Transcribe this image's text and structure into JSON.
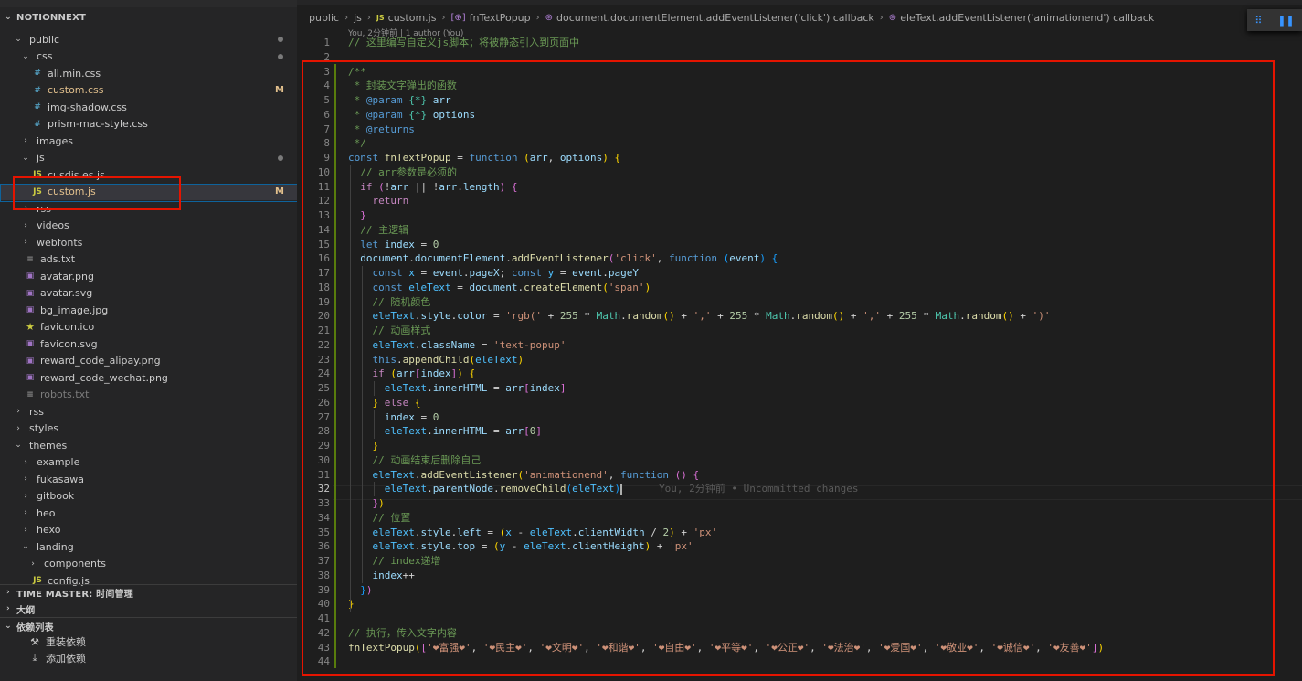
{
  "sidebar": {
    "root_title": "NOTIONNEXT",
    "items": [
      {
        "label": "public",
        "kind": "folder-open",
        "depth": 0,
        "status": "dot"
      },
      {
        "label": "css",
        "kind": "folder-open",
        "depth": 1,
        "status": "dot"
      },
      {
        "label": "all.min.css",
        "kind": "css",
        "depth": 2,
        "status": ""
      },
      {
        "label": "custom.css",
        "kind": "css",
        "depth": 2,
        "status": "M",
        "modified": true
      },
      {
        "label": "img-shadow.css",
        "kind": "css",
        "depth": 2,
        "status": ""
      },
      {
        "label": "prism-mac-style.css",
        "kind": "css",
        "depth": 2,
        "status": ""
      },
      {
        "label": "images",
        "kind": "folder",
        "depth": 1,
        "status": ""
      },
      {
        "label": "js",
        "kind": "folder-open",
        "depth": 1,
        "status": "dot"
      },
      {
        "label": "cusdis.es.js",
        "kind": "js",
        "depth": 2,
        "status": ""
      },
      {
        "label": "custom.js",
        "kind": "js",
        "depth": 2,
        "status": "M",
        "modified": true,
        "selected": true
      },
      {
        "label": "rss",
        "kind": "folder",
        "depth": 1,
        "status": ""
      },
      {
        "label": "videos",
        "kind": "folder",
        "depth": 1,
        "status": ""
      },
      {
        "label": "webfonts",
        "kind": "folder",
        "depth": 1,
        "status": ""
      },
      {
        "label": "ads.txt",
        "kind": "txt",
        "depth": 1,
        "status": ""
      },
      {
        "label": "avatar.png",
        "kind": "img",
        "depth": 1,
        "status": ""
      },
      {
        "label": "avatar.svg",
        "kind": "img",
        "depth": 1,
        "status": ""
      },
      {
        "label": "bg_image.jpg",
        "kind": "img",
        "depth": 1,
        "status": ""
      },
      {
        "label": "favicon.ico",
        "kind": "star",
        "depth": 1,
        "status": ""
      },
      {
        "label": "favicon.svg",
        "kind": "img",
        "depth": 1,
        "status": ""
      },
      {
        "label": "reward_code_alipay.png",
        "kind": "img",
        "depth": 1,
        "status": ""
      },
      {
        "label": "reward_code_wechat.png",
        "kind": "img",
        "depth": 1,
        "status": ""
      },
      {
        "label": "robots.txt",
        "kind": "txt",
        "depth": 1,
        "status": "",
        "ignored": true
      },
      {
        "label": "rss",
        "kind": "folder",
        "depth": 0,
        "status": ""
      },
      {
        "label": "styles",
        "kind": "folder",
        "depth": 0,
        "status": ""
      },
      {
        "label": "themes",
        "kind": "folder-open",
        "depth": 0,
        "status": ""
      },
      {
        "label": "example",
        "kind": "folder",
        "depth": 1,
        "status": ""
      },
      {
        "label": "fukasawa",
        "kind": "folder",
        "depth": 1,
        "status": ""
      },
      {
        "label": "gitbook",
        "kind": "folder",
        "depth": 1,
        "status": ""
      },
      {
        "label": "heo",
        "kind": "folder",
        "depth": 1,
        "status": ""
      },
      {
        "label": "hexo",
        "kind": "folder",
        "depth": 1,
        "status": ""
      },
      {
        "label": "landing",
        "kind": "folder-open",
        "depth": 1,
        "status": ""
      },
      {
        "label": "components",
        "kind": "folder",
        "depth": 2,
        "status": ""
      },
      {
        "label": "config.js",
        "kind": "js",
        "depth": 2,
        "status": ""
      }
    ],
    "timeline_title": "TIME MASTER: 时间管理",
    "outline_title": "大纲",
    "deps_title": "依赖列表",
    "deps": [
      {
        "label": "重装依赖",
        "icon": "wrench-icon"
      },
      {
        "label": "添加依赖",
        "icon": "download-icon"
      }
    ]
  },
  "breadcrumb": [
    "public",
    "js",
    "custom.js",
    "fnTextPopup",
    "document.documentElement.addEventListener('click') callback",
    "eleText.addEventListener('animationend') callback"
  ],
  "blame_header": "You, 2分钟前 | 1 author (You)",
  "inline_blame": "You, 2分钟前 • Uncommitted changes",
  "active_line": 32,
  "colors": {
    "accent": "#0e639c",
    "highlight_box": "#e51400",
    "git_added": "#587c0c"
  },
  "code": [
    [
      [
        "t-cm",
        "// 这里编写自定义js脚本；将被静态引入到页面中"
      ]
    ],
    [],
    [
      [
        "t-cm",
        "/**"
      ]
    ],
    [
      [
        "t-cm",
        " * 封装文字弹出的函数"
      ]
    ],
    [
      [
        "t-cm",
        " * "
      ],
      [
        "t-doc",
        "@param"
      ],
      [
        "t-cm",
        " "
      ],
      [
        "t-ty",
        "{*}"
      ],
      [
        "t-cm",
        " "
      ],
      [
        "t-var",
        "arr"
      ]
    ],
    [
      [
        "t-cm",
        " * "
      ],
      [
        "t-doc",
        "@param"
      ],
      [
        "t-cm",
        " "
      ],
      [
        "t-ty",
        "{*}"
      ],
      [
        "t-cm",
        " "
      ],
      [
        "t-var",
        "options"
      ]
    ],
    [
      [
        "t-cm",
        " * "
      ],
      [
        "t-doc",
        "@returns"
      ]
    ],
    [
      [
        "t-cm",
        " */"
      ]
    ],
    [
      [
        "t-kw",
        "const"
      ],
      [
        "t-pu",
        " "
      ],
      [
        "t-fn",
        "fnTextPopup"
      ],
      [
        "t-pu",
        " = "
      ],
      [
        "t-kw",
        "function"
      ],
      [
        "t-pu",
        " "
      ],
      [
        "t-br1",
        "("
      ],
      [
        "t-var",
        "arr"
      ],
      [
        "t-pu",
        ", "
      ],
      [
        "t-var",
        "options"
      ],
      [
        "t-br1",
        ")"
      ],
      [
        "t-pu",
        " "
      ],
      [
        "t-br1",
        "{"
      ]
    ],
    [
      [
        "t-pu",
        "  "
      ],
      [
        "t-cm",
        "// arr参数是必须的"
      ]
    ],
    [
      [
        "t-pu",
        "  "
      ],
      [
        "t-kw2",
        "if"
      ],
      [
        "t-pu",
        " "
      ],
      [
        "t-br2",
        "("
      ],
      [
        "t-pu",
        "!"
      ],
      [
        "t-var",
        "arr"
      ],
      [
        "t-pu",
        " || !"
      ],
      [
        "t-var",
        "arr"
      ],
      [
        "t-pu",
        "."
      ],
      [
        "t-var",
        "length"
      ],
      [
        "t-br2",
        ")"
      ],
      [
        "t-pu",
        " "
      ],
      [
        "t-br2",
        "{"
      ]
    ],
    [
      [
        "t-pu",
        "    "
      ],
      [
        "t-kw2",
        "return"
      ]
    ],
    [
      [
        "t-pu",
        "  "
      ],
      [
        "t-br2",
        "}"
      ]
    ],
    [
      [
        "t-pu",
        "  "
      ],
      [
        "t-cm",
        "// 主逻辑"
      ]
    ],
    [
      [
        "t-pu",
        "  "
      ],
      [
        "t-kw",
        "let"
      ],
      [
        "t-pu",
        " "
      ],
      [
        "t-var",
        "index"
      ],
      [
        "t-pu",
        " = "
      ],
      [
        "t-num",
        "0"
      ]
    ],
    [
      [
        "t-pu",
        "  "
      ],
      [
        "t-var",
        "document"
      ],
      [
        "t-pu",
        "."
      ],
      [
        "t-var",
        "documentElement"
      ],
      [
        "t-pu",
        "."
      ],
      [
        "t-fn",
        "addEventListener"
      ],
      [
        "t-br2",
        "("
      ],
      [
        "t-str",
        "'click'"
      ],
      [
        "t-pu",
        ", "
      ],
      [
        "t-kw",
        "function"
      ],
      [
        "t-pu",
        " "
      ],
      [
        "t-br3",
        "("
      ],
      [
        "t-var",
        "event"
      ],
      [
        "t-br3",
        ")"
      ],
      [
        "t-pu",
        " "
      ],
      [
        "t-br3",
        "{"
      ]
    ],
    [
      [
        "t-pu",
        "    "
      ],
      [
        "t-kw",
        "const"
      ],
      [
        "t-pu",
        " "
      ],
      [
        "t-const",
        "x"
      ],
      [
        "t-pu",
        " = "
      ],
      [
        "t-var",
        "event"
      ],
      [
        "t-pu",
        "."
      ],
      [
        "t-var",
        "pageX"
      ],
      [
        "t-pu",
        "; "
      ],
      [
        "t-kw",
        "const"
      ],
      [
        "t-pu",
        " "
      ],
      [
        "t-const",
        "y"
      ],
      [
        "t-pu",
        " = "
      ],
      [
        "t-var",
        "event"
      ],
      [
        "t-pu",
        "."
      ],
      [
        "t-var",
        "pageY"
      ]
    ],
    [
      [
        "t-pu",
        "    "
      ],
      [
        "t-kw",
        "const"
      ],
      [
        "t-pu",
        " "
      ],
      [
        "t-const",
        "eleText"
      ],
      [
        "t-pu",
        " = "
      ],
      [
        "t-var",
        "document"
      ],
      [
        "t-pu",
        "."
      ],
      [
        "t-fn",
        "createElement"
      ],
      [
        "t-br1",
        "("
      ],
      [
        "t-str",
        "'span'"
      ],
      [
        "t-br1",
        ")"
      ]
    ],
    [
      [
        "t-pu",
        "    "
      ],
      [
        "t-cm",
        "// 随机颜色"
      ]
    ],
    [
      [
        "t-pu",
        "    "
      ],
      [
        "t-const",
        "eleText"
      ],
      [
        "t-pu",
        "."
      ],
      [
        "t-var",
        "style"
      ],
      [
        "t-pu",
        "."
      ],
      [
        "t-var",
        "color"
      ],
      [
        "t-pu",
        " = "
      ],
      [
        "t-str",
        "'rgb('"
      ],
      [
        "t-pu",
        " + "
      ],
      [
        "t-num",
        "255"
      ],
      [
        "t-pu",
        " * "
      ],
      [
        "t-ty",
        "Math"
      ],
      [
        "t-pu",
        "."
      ],
      [
        "t-fn",
        "random"
      ],
      [
        "t-br1",
        "()"
      ],
      [
        "t-pu",
        " + "
      ],
      [
        "t-str",
        "','"
      ],
      [
        "t-pu",
        " + "
      ],
      [
        "t-num",
        "255"
      ],
      [
        "t-pu",
        " * "
      ],
      [
        "t-ty",
        "Math"
      ],
      [
        "t-pu",
        "."
      ],
      [
        "t-fn",
        "random"
      ],
      [
        "t-br1",
        "()"
      ],
      [
        "t-pu",
        " + "
      ],
      [
        "t-str",
        "','"
      ],
      [
        "t-pu",
        " + "
      ],
      [
        "t-num",
        "255"
      ],
      [
        "t-pu",
        " * "
      ],
      [
        "t-ty",
        "Math"
      ],
      [
        "t-pu",
        "."
      ],
      [
        "t-fn",
        "random"
      ],
      [
        "t-br1",
        "()"
      ],
      [
        "t-pu",
        " + "
      ],
      [
        "t-str",
        "')'"
      ]
    ],
    [
      [
        "t-pu",
        "    "
      ],
      [
        "t-cm",
        "// 动画样式"
      ]
    ],
    [
      [
        "t-pu",
        "    "
      ],
      [
        "t-const",
        "eleText"
      ],
      [
        "t-pu",
        "."
      ],
      [
        "t-var",
        "className"
      ],
      [
        "t-pu",
        " = "
      ],
      [
        "t-str",
        "'text-popup'"
      ]
    ],
    [
      [
        "t-pu",
        "    "
      ],
      [
        "t-kw",
        "this"
      ],
      [
        "t-pu",
        "."
      ],
      [
        "t-fn",
        "appendChild"
      ],
      [
        "t-br1",
        "("
      ],
      [
        "t-const",
        "eleText"
      ],
      [
        "t-br1",
        ")"
      ]
    ],
    [
      [
        "t-pu",
        "    "
      ],
      [
        "t-kw2",
        "if"
      ],
      [
        "t-pu",
        " "
      ],
      [
        "t-br1",
        "("
      ],
      [
        "t-var",
        "arr"
      ],
      [
        "t-br2",
        "["
      ],
      [
        "t-var",
        "index"
      ],
      [
        "t-br2",
        "]"
      ],
      [
        "t-br1",
        ")"
      ],
      [
        "t-pu",
        " "
      ],
      [
        "t-br1",
        "{"
      ]
    ],
    [
      [
        "t-pu",
        "      "
      ],
      [
        "t-const",
        "eleText"
      ],
      [
        "t-pu",
        "."
      ],
      [
        "t-var",
        "innerHTML"
      ],
      [
        "t-pu",
        " = "
      ],
      [
        "t-var",
        "arr"
      ],
      [
        "t-br2",
        "["
      ],
      [
        "t-var",
        "index"
      ],
      [
        "t-br2",
        "]"
      ]
    ],
    [
      [
        "t-pu",
        "    "
      ],
      [
        "t-br1",
        "}"
      ],
      [
        "t-pu",
        " "
      ],
      [
        "t-kw2",
        "else"
      ],
      [
        "t-pu",
        " "
      ],
      [
        "t-br1",
        "{"
      ]
    ],
    [
      [
        "t-pu",
        "      "
      ],
      [
        "t-var",
        "index"
      ],
      [
        "t-pu",
        " = "
      ],
      [
        "t-num",
        "0"
      ]
    ],
    [
      [
        "t-pu",
        "      "
      ],
      [
        "t-const",
        "eleText"
      ],
      [
        "t-pu",
        "."
      ],
      [
        "t-var",
        "innerHTML"
      ],
      [
        "t-pu",
        " = "
      ],
      [
        "t-var",
        "arr"
      ],
      [
        "t-br2",
        "["
      ],
      [
        "t-num",
        "0"
      ],
      [
        "t-br2",
        "]"
      ]
    ],
    [
      [
        "t-pu",
        "    "
      ],
      [
        "t-br1",
        "}"
      ]
    ],
    [
      [
        "t-pu",
        "    "
      ],
      [
        "t-cm",
        "// 动画结束后删除自己"
      ]
    ],
    [
      [
        "t-pu",
        "    "
      ],
      [
        "t-const",
        "eleText"
      ],
      [
        "t-pu",
        "."
      ],
      [
        "t-fn",
        "addEventListener"
      ],
      [
        "t-br1",
        "("
      ],
      [
        "t-str",
        "'animationend'"
      ],
      [
        "t-pu",
        ", "
      ],
      [
        "t-kw",
        "function"
      ],
      [
        "t-pu",
        " "
      ],
      [
        "t-br2",
        "()"
      ],
      [
        "t-pu",
        " "
      ],
      [
        "t-br2",
        "{"
      ]
    ],
    [
      [
        "t-pu",
        "      "
      ],
      [
        "t-const",
        "eleText"
      ],
      [
        "t-pu",
        "."
      ],
      [
        "t-var",
        "parentNode"
      ],
      [
        "t-pu",
        "."
      ],
      [
        "t-fn",
        "removeChild"
      ],
      [
        "t-br3",
        "("
      ],
      [
        "t-const",
        "eleText"
      ],
      [
        "t-br3",
        ")"
      ]
    ],
    [
      [
        "t-pu",
        "    "
      ],
      [
        "t-br2",
        "}"
      ],
      [
        "t-br1",
        ")"
      ]
    ],
    [
      [
        "t-pu",
        "    "
      ],
      [
        "t-cm",
        "// 位置"
      ]
    ],
    [
      [
        "t-pu",
        "    "
      ],
      [
        "t-const",
        "eleText"
      ],
      [
        "t-pu",
        "."
      ],
      [
        "t-var",
        "style"
      ],
      [
        "t-pu",
        "."
      ],
      [
        "t-var",
        "left"
      ],
      [
        "t-pu",
        " = "
      ],
      [
        "t-br1",
        "("
      ],
      [
        "t-const",
        "x"
      ],
      [
        "t-pu",
        " - "
      ],
      [
        "t-const",
        "eleText"
      ],
      [
        "t-pu",
        "."
      ],
      [
        "t-var",
        "clientWidth"
      ],
      [
        "t-pu",
        " / "
      ],
      [
        "t-num",
        "2"
      ],
      [
        "t-br1",
        ")"
      ],
      [
        "t-pu",
        " + "
      ],
      [
        "t-str",
        "'px'"
      ]
    ],
    [
      [
        "t-pu",
        "    "
      ],
      [
        "t-const",
        "eleText"
      ],
      [
        "t-pu",
        "."
      ],
      [
        "t-var",
        "style"
      ],
      [
        "t-pu",
        "."
      ],
      [
        "t-var",
        "top"
      ],
      [
        "t-pu",
        " = "
      ],
      [
        "t-br1",
        "("
      ],
      [
        "t-const",
        "y"
      ],
      [
        "t-pu",
        " - "
      ],
      [
        "t-const",
        "eleText"
      ],
      [
        "t-pu",
        "."
      ],
      [
        "t-var",
        "clientHeight"
      ],
      [
        "t-br1",
        ")"
      ],
      [
        "t-pu",
        " + "
      ],
      [
        "t-str",
        "'px'"
      ]
    ],
    [
      [
        "t-pu",
        "    "
      ],
      [
        "t-cm",
        "// index递增"
      ]
    ],
    [
      [
        "t-pu",
        "    "
      ],
      [
        "t-var",
        "index"
      ],
      [
        "t-pu",
        "++"
      ]
    ],
    [
      [
        "t-pu",
        "  "
      ],
      [
        "t-br3",
        "}"
      ],
      [
        "t-br2",
        ")"
      ]
    ],
    [
      [
        "t-br1",
        "}"
      ]
    ],
    [],
    [
      [
        "t-cm",
        "// 执行，传入文字内容"
      ]
    ],
    [
      [
        "t-fn",
        "fnTextPopup"
      ],
      [
        "t-br1",
        "("
      ],
      [
        "t-br2",
        "["
      ],
      [
        "t-str",
        "'❤富强❤'"
      ],
      [
        "t-pu",
        ", "
      ],
      [
        "t-str",
        "'❤民主❤'"
      ],
      [
        "t-pu",
        ", "
      ],
      [
        "t-str",
        "'❤文明❤'"
      ],
      [
        "t-pu",
        ", "
      ],
      [
        "t-str",
        "'❤和谐❤'"
      ],
      [
        "t-pu",
        ", "
      ],
      [
        "t-str",
        "'❤自由❤'"
      ],
      [
        "t-pu",
        ", "
      ],
      [
        "t-str",
        "'❤平等❤'"
      ],
      [
        "t-pu",
        ", "
      ],
      [
        "t-str",
        "'❤公正❤'"
      ],
      [
        "t-pu",
        ", "
      ],
      [
        "t-str",
        "'❤法治❤'"
      ],
      [
        "t-pu",
        ", "
      ],
      [
        "t-str",
        "'❤爱国❤'"
      ],
      [
        "t-pu",
        ", "
      ],
      [
        "t-str",
        "'❤敬业❤'"
      ],
      [
        "t-pu",
        ", "
      ],
      [
        "t-str",
        "'❤诚信❤'"
      ],
      [
        "t-pu",
        ", "
      ],
      [
        "t-str",
        "'❤友善❤'"
      ],
      [
        "t-br2",
        "]"
      ],
      [
        "t-br1",
        ")"
      ]
    ],
    []
  ]
}
